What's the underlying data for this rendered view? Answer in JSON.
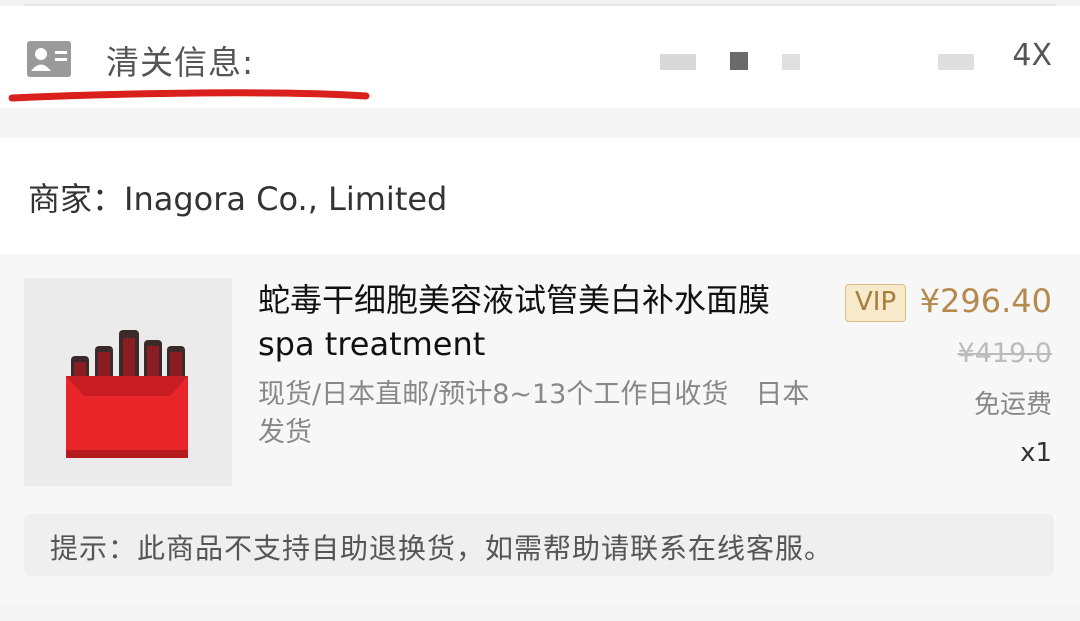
{
  "customs": {
    "label": "清关信息:",
    "id_suffix": "4X"
  },
  "merchant": {
    "text": "商家：Inagora Co., Limited"
  },
  "product": {
    "title": "蛇毒干细胞美容液试管美白补水面膜spa treatment",
    "meta": "现货/日本直邮/预计8~13个工作日收货　日本发货",
    "vip_label": "VIP",
    "price": "¥296.40",
    "original_price": "¥419.0",
    "shipping": "免运费",
    "quantity": "x1"
  },
  "notice": {
    "text": "提示：此商品不支持自助退换货，如需帮助请联系在线客服。"
  },
  "colors": {
    "price": "#b58a4d",
    "underline": "#d9201c",
    "product_box": "#e8262a"
  },
  "icons": {
    "customs": "id-card-icon"
  }
}
